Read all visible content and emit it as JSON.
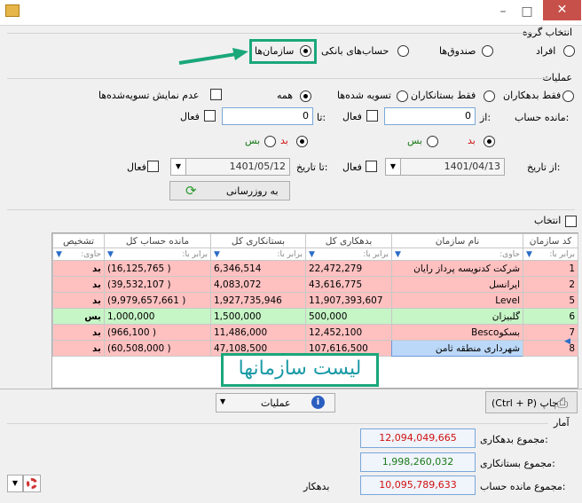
{
  "group": {
    "title": "انتخاب گروه",
    "options": [
      "افراد",
      "صندوق‌ها",
      "حساب‌های بانکی",
      "سازمان‌ها"
    ],
    "selected": "سازمان‌ها"
  },
  "ops": {
    "title": "عملیات",
    "filter_options": [
      "فقط بدهکاران",
      "فقط بستانکاران",
      "تسویه شده‌ها",
      "همه"
    ],
    "hide_settled": "عدم نمایش تسویه‌شده‌ها",
    "balance_label": "مانده حساب:",
    "from_label": "از:",
    "to_label": "تا:",
    "from_value": "0",
    "to_value": "0",
    "active_label": "فعال",
    "bed": "بد",
    "bes": "بس",
    "from_date_label": "از تاریخ:",
    "to_date_label": "تا تاریخ:",
    "from_date": "1401/04/13",
    "to_date": "1401/05/12",
    "update_button": "به روزرسانی"
  },
  "select_all": "انتخاب",
  "grid": {
    "headers": [
      "کد سازمان",
      "نام سازمان",
      "بدهکاری کل",
      "بستانکاری کل",
      "مانده حساب کل",
      "تشخیص"
    ],
    "filter_eq": "برابر با:",
    "filter_contains": "حاوی:",
    "rows": [
      {
        "code": "1",
        "name": "شرکت کدنویسه پرداز رایان",
        "debit": "22,472,279",
        "credit": "6,346,514",
        "balance": "(16,125,765 )",
        "status": "بد",
        "tone": "red"
      },
      {
        "code": "2",
        "name": "ایرانسل",
        "debit": "43,616,775",
        "credit": "4,083,072",
        "balance": "(39,532,107 )",
        "status": "بد",
        "tone": "red"
      },
      {
        "code": "5",
        "name": "Level",
        "debit": "11,907,393,607",
        "credit": "1,927,735,946",
        "balance": "(9,979,657,661 )",
        "status": "بد",
        "tone": "red"
      },
      {
        "code": "6",
        "name": "گلبیزان",
        "debit": "500,000",
        "credit": "1,500,000",
        "balance": "1,000,000",
        "status": "بس",
        "tone": "green"
      },
      {
        "code": "7",
        "name": "بسکوBesco",
        "debit": "12,452,100",
        "credit": "11,486,000",
        "balance": "(966,100 )",
        "status": "بد",
        "tone": "red"
      },
      {
        "code": "8",
        "name": "شهرداری منطقه ثامن",
        "debit": "107,616,500",
        "credit": "47,108,500",
        "balance": "(60,508,000 )",
        "status": "بد",
        "tone": "red"
      }
    ]
  },
  "overlay_label": "لیست سازمانها",
  "operations_button": "عملیات",
  "print_button": "(Ctrl + P) چاپ",
  "stats": {
    "title": "آمار",
    "total_debit_label": "مجموع بدهکاری:",
    "total_debit": "12,094,049,665",
    "total_credit_label": "مجموع بستانکاری:",
    "total_credit": "1,998,260,032",
    "total_balance_label": "مجموع مانده حساب:",
    "total_balance": "10,095,789,633",
    "balance_status": "بدهکار"
  },
  "colors": {
    "debit": "#d01010",
    "credit": "#1a7a1a",
    "accent": "#1aa77a"
  }
}
